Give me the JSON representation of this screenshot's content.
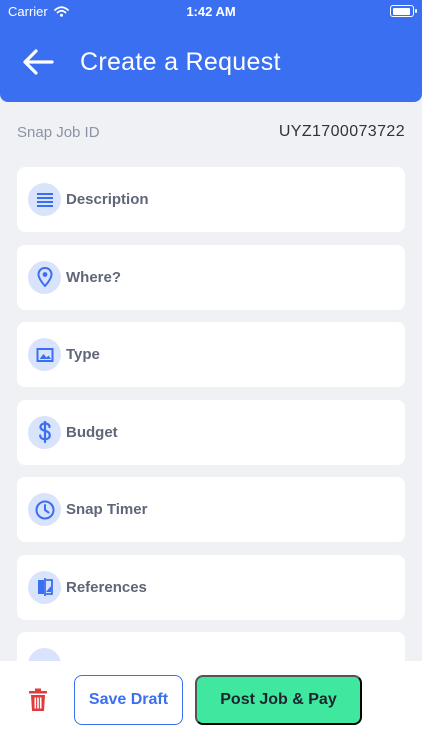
{
  "status_bar": {
    "carrier": "Carrier",
    "time": "1:42 AM"
  },
  "header": {
    "title": "Create a Request"
  },
  "snap_job": {
    "label": "Snap Job ID",
    "value": "UYZ1700073722"
  },
  "items": [
    {
      "label": "Description",
      "icon": "list-lines-icon"
    },
    {
      "label": "Where?",
      "icon": "location-pin-icon"
    },
    {
      "label": "Type",
      "icon": "image-icon"
    },
    {
      "label": "Budget",
      "icon": "dollar-icon"
    },
    {
      "label": "Snap Timer",
      "icon": "clock-icon"
    },
    {
      "label": "References",
      "icon": "compare-icon"
    }
  ],
  "footer": {
    "save_draft_label": "Save Draft",
    "post_label": "Post Job & Pay"
  },
  "colors": {
    "primary": "#3B6FF2",
    "accent_green": "#3FE89E",
    "delete_red": "#E23B3B",
    "icon_bg": "#D9E3FC"
  }
}
